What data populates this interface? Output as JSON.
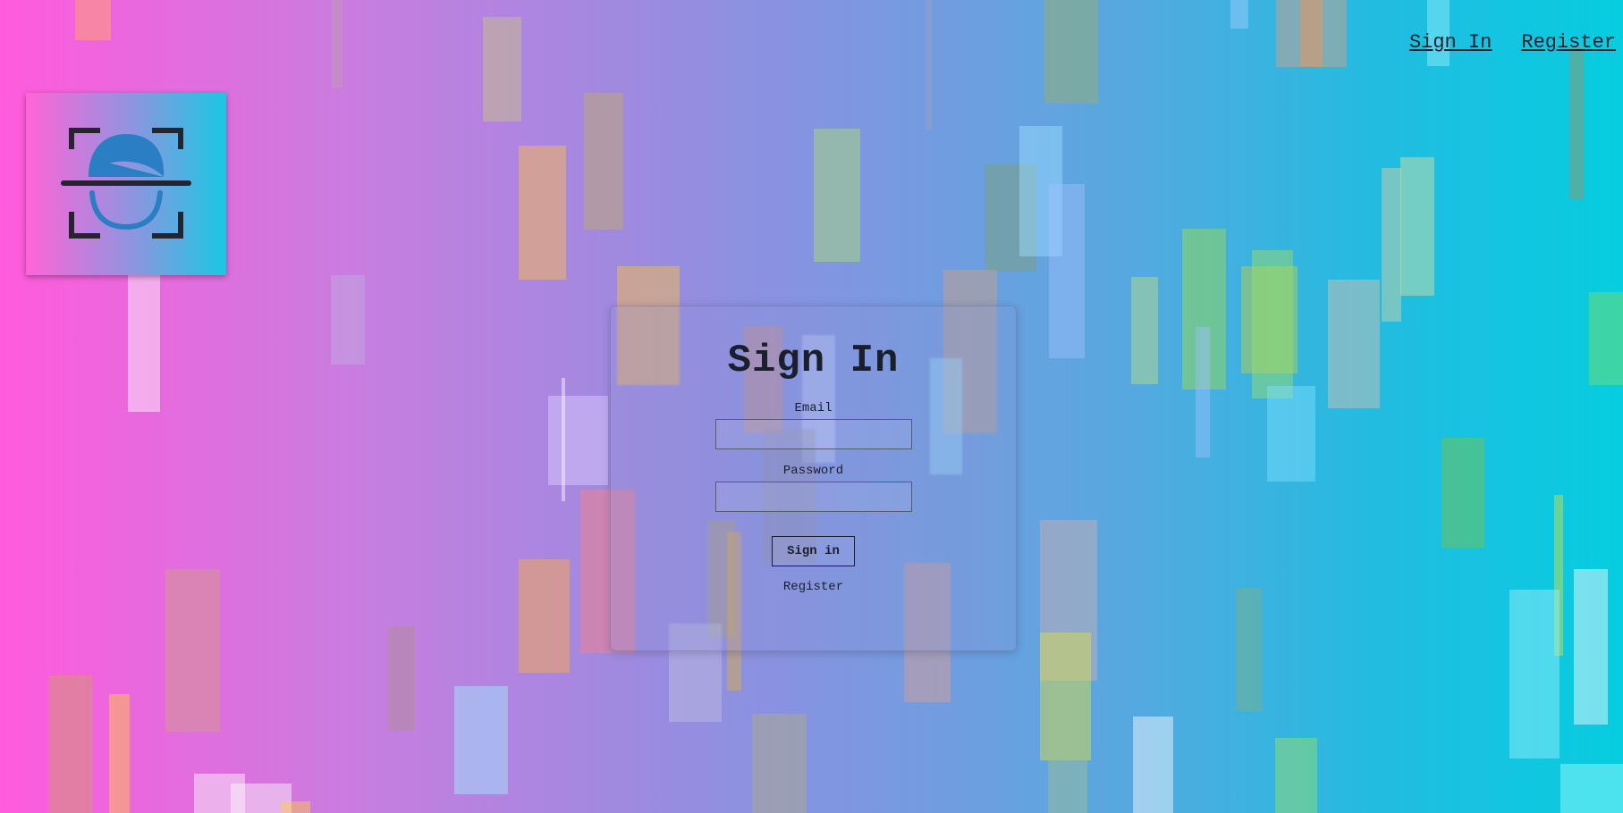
{
  "nav": {
    "sign_in": "Sign In",
    "register": "Register"
  },
  "logo": {
    "icon": "face-scan-icon"
  },
  "form": {
    "title": "Sign In",
    "email_label": "Email",
    "email_value": "",
    "password_label": "Password",
    "password_value": "",
    "submit_label": "Sign in",
    "register_link": "Register"
  },
  "colors": {
    "gradient_start": "#ff5bdc",
    "gradient_end": "#06cde0",
    "text": "#1a1f2e",
    "logo_face": "#2a7fc4"
  }
}
